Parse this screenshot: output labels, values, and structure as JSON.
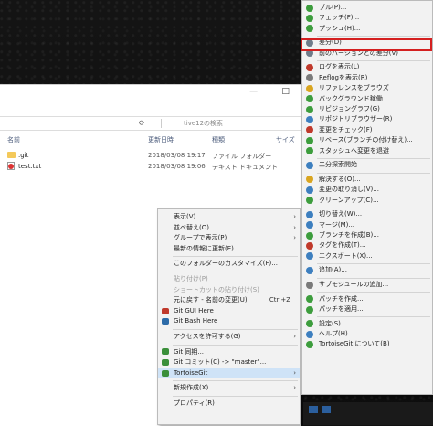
{
  "explorer": {
    "minimize_glyph": "—",
    "maximize_glyph": "□",
    "search_placeholder": "tive12の検索",
    "columns": [
      "名前",
      "更新日時",
      "種類",
      "サイズ"
    ],
    "files": [
      {
        "name": ".git",
        "date": "2018/03/08 19:17",
        "type": "ファイル フォルダー",
        "kind": "folder"
      },
      {
        "name": "test.txt",
        "date": "2018/03/08 19:06",
        "type": "テキスト ドキュメント",
        "kind": "file"
      }
    ]
  },
  "context_menu": {
    "items": [
      {
        "label": "表示(V)",
        "arrow": "›"
      },
      {
        "label": "並べ替え(O)",
        "arrow": "›"
      },
      {
        "label": "グループで表示(P)",
        "arrow": "›"
      },
      {
        "label": "最新の情報に更新(E)"
      },
      {
        "sep": true
      },
      {
        "label": "このフォルダーのカスタマイズ(F)..."
      },
      {
        "sep": true
      },
      {
        "label": "貼り付け(P)",
        "disabled": true
      },
      {
        "label": "ショートカットの貼り付け(S)",
        "disabled": true
      },
      {
        "label": "元に戻す - 名前の変更(U)",
        "shortcut": "Ctrl+Z"
      },
      {
        "label": "Git GUI Here",
        "icon": "#c0392b"
      },
      {
        "label": "Git Bash Here",
        "icon": "#2d6ba8"
      },
      {
        "sep": true
      },
      {
        "label": "アクセスを許可する(G)",
        "arrow": "›"
      },
      {
        "sep": true
      },
      {
        "label": "Git 同期...",
        "icon": "#3a8f3a"
      },
      {
        "label": "Git コミット(C) -> \"master\"...",
        "icon": "#3a8f3a"
      },
      {
        "label": "TortoiseGit",
        "icon": "#3a8f3a",
        "arrow": "›",
        "hover": true
      },
      {
        "sep": true
      },
      {
        "label": "新規作成(X)",
        "arrow": "›"
      },
      {
        "sep": true
      },
      {
        "label": "プロパティ(R)"
      }
    ]
  },
  "tortoise_menu": {
    "items": [
      {
        "label": "プル(P)...",
        "icon": "#3d9d3d"
      },
      {
        "label": "フェッチ(F)...",
        "icon": "#3d9d3d"
      },
      {
        "label": "プッシュ(H)...",
        "icon": "#3d9d3d"
      },
      {
        "sep": true
      },
      {
        "label": "差分(D)",
        "icon": "#6f7c8a",
        "highlight": true
      },
      {
        "label": "前のバージョンとの差分(V)",
        "icon": "#6f7c8a"
      },
      {
        "sep": true
      },
      {
        "label": "ログを表示(L)",
        "icon": "#c0392b"
      },
      {
        "label": "Reflogを表示(R)",
        "icon": "#7a7a7a"
      },
      {
        "label": "リファレンスをブラウズ",
        "icon": "#d9a520"
      },
      {
        "label": "バックグラウンド稼働",
        "icon": "#3d9d3d"
      },
      {
        "label": "リビジョングラフ(G)",
        "icon": "#3d9d3d"
      },
      {
        "label": "リポジトリブラウザー(R)",
        "icon": "#3d7fbf"
      },
      {
        "label": "変更をチェック(F)",
        "icon": "#c0392b"
      },
      {
        "label": "リベース(ブランチの付け替え)...",
        "icon": "#3d9d3d"
      },
      {
        "label": "スタッシュへ変更を退避",
        "icon": "#3d9d3d"
      },
      {
        "sep": true
      },
      {
        "label": "二分探索開始",
        "icon": "#3d7fbf"
      },
      {
        "sep": true
      },
      {
        "label": "解決する(O)...",
        "icon": "#d9a520"
      },
      {
        "label": "変更の取り消し(V)...",
        "icon": "#3d7fbf"
      },
      {
        "label": "クリーンアップ(C)...",
        "icon": "#3d9d3d"
      },
      {
        "sep": true
      },
      {
        "label": "切り替え(W)...",
        "icon": "#3d7fbf"
      },
      {
        "label": "マージ(M)...",
        "icon": "#3d7fbf"
      },
      {
        "label": "ブランチを作成(B)...",
        "icon": "#3d9d3d"
      },
      {
        "label": "タグを作成(T)...",
        "icon": "#c0392b"
      },
      {
        "label": "エクスポート(X)...",
        "icon": "#3d7fbf"
      },
      {
        "sep": true
      },
      {
        "label": "追加(A)...",
        "icon": "#3d7fbf"
      },
      {
        "sep": true
      },
      {
        "label": "サブモジュールの追加...",
        "icon": "#7a7a7a"
      },
      {
        "sep": true
      },
      {
        "label": "パッチを作成...",
        "icon": "#3d9d3d"
      },
      {
        "label": "パッチを適用...",
        "icon": "#3d9d3d"
      },
      {
        "sep": true
      },
      {
        "label": "設定(S)",
        "icon": "#3d9d3d"
      },
      {
        "label": "ヘルプ(H)",
        "icon": "#3d7fbf"
      },
      {
        "label": "TortoiseGit について(B)",
        "icon": "#3d9d3d"
      }
    ]
  },
  "accent": {
    "highlight_border": "#d42020",
    "hover": "#cfe3f7"
  }
}
